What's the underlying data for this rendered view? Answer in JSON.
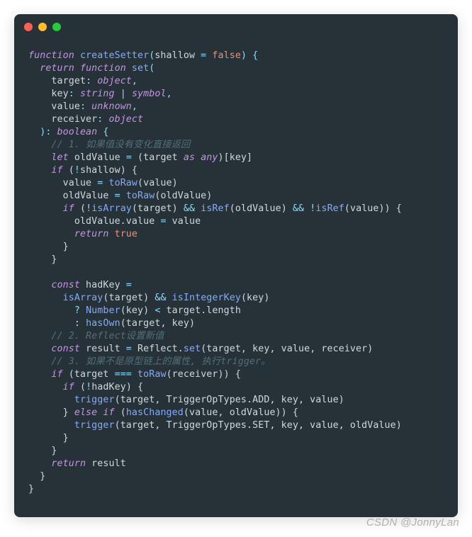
{
  "window": {
    "dots": [
      "red",
      "yellow",
      "green"
    ]
  },
  "code": {
    "l1": {
      "a": "function",
      "b": " ",
      "c": "createSetter",
      "d": "(",
      "e": "shallow",
      "f": " = ",
      "g": "false",
      "h": ") {"
    },
    "l2": {
      "a": "  ",
      "b": "return",
      "c": " ",
      "d": "function",
      "e": " ",
      "f": "set",
      "g": "("
    },
    "l3": {
      "a": "    ",
      "b": "target",
      "c": ": ",
      "d": "object",
      "e": ","
    },
    "l4": {
      "a": "    ",
      "b": "key",
      "c": ": ",
      "d": "string",
      "e": " | ",
      "f": "symbol",
      "g": ","
    },
    "l5": {
      "a": "    ",
      "b": "value",
      "c": ": ",
      "d": "unknown",
      "e": ","
    },
    "l6": {
      "a": "    ",
      "b": "receiver",
      "c": ": ",
      "d": "object"
    },
    "l7": {
      "a": "  ): ",
      "b": "boolean",
      "c": " {"
    },
    "l8": {
      "a": "    ",
      "b": "// 1. 如果值没有变化直接返回"
    },
    "l9": {
      "a": "    ",
      "b": "let",
      "c": " oldValue ",
      "d": "=",
      "e": " (target ",
      "f": "as",
      "g": " ",
      "h": "any",
      "i": ")[key]"
    },
    "l10": {
      "a": "    ",
      "b": "if",
      "c": " (",
      "d": "!",
      "e": "shallow) {"
    },
    "l11": {
      "a": "      value ",
      "b": "=",
      "c": " ",
      "d": "toRaw",
      "e": "(value)"
    },
    "l12": {
      "a": "      oldValue ",
      "b": "=",
      "c": " ",
      "d": "toRaw",
      "e": "(oldValue)"
    },
    "l13": {
      "a": "      ",
      "b": "if",
      "c": " (",
      "d": "!",
      "e": "isArray",
      "f": "(target) ",
      "g": "&&",
      "h": " ",
      "i": "isRef",
      "j": "(oldValue) ",
      "k": "&&",
      "l": " ",
      "m": "!",
      "n": "isRef",
      "o": "(value)) {"
    },
    "l14": {
      "a": "        oldValue.value ",
      "b": "=",
      "c": " value"
    },
    "l15": {
      "a": "        ",
      "b": "return",
      "c": " ",
      "d": "true"
    },
    "l16": {
      "a": "      }"
    },
    "l17": {
      "a": "    }"
    },
    "l18": {
      "a": ""
    },
    "l19": {
      "a": "    ",
      "b": "const",
      "c": " hadKey ",
      "d": "="
    },
    "l20": {
      "a": "      ",
      "b": "isArray",
      "c": "(target) ",
      "d": "&&",
      "e": " ",
      "f": "isIntegerKey",
      "g": "(key)"
    },
    "l21": {
      "a": "        ",
      "b": "?",
      "c": " ",
      "d": "Number",
      "e": "(key) ",
      "f": "<",
      "g": " target.length"
    },
    "l22": {
      "a": "        : ",
      "b": "hasOwn",
      "c": "(target, key)"
    },
    "l23": {
      "a": "    ",
      "b": "// 2. Reflect设置新值"
    },
    "l24": {
      "a": "    ",
      "b": "const",
      "c": " result ",
      "d": "=",
      "e": " Reflect.",
      "f": "set",
      "g": "(target, key, value, receiver)"
    },
    "l25": {
      "a": "    ",
      "b": "// 3. 如果不是原型链上的属性, 执行trigger。"
    },
    "l26": {
      "a": "    ",
      "b": "if",
      "c": " (target ",
      "d": "===",
      "e": " ",
      "f": "toRaw",
      "g": "(receiver)) {"
    },
    "l27": {
      "a": "      ",
      "b": "if",
      "c": " (",
      "d": "!",
      "e": "hadKey) {"
    },
    "l28": {
      "a": "        ",
      "b": "trigger",
      "c": "(target, TriggerOpTypes.ADD, key, value)"
    },
    "l29": {
      "a": "      } ",
      "b": "else",
      "c": " ",
      "d": "if",
      "e": " (",
      "f": "hasChanged",
      "g": "(value, oldValue)) {"
    },
    "l30": {
      "a": "        ",
      "b": "trigger",
      "c": "(target, TriggerOpTypes.SET, key, value, oldValue)"
    },
    "l31": {
      "a": "      }"
    },
    "l32": {
      "a": "    }"
    },
    "l33": {
      "a": "    ",
      "b": "return",
      "c": " result"
    },
    "l34": {
      "a": "  }"
    },
    "l35": {
      "a": "}"
    }
  },
  "watermark": "CSDN @JonnyLan"
}
